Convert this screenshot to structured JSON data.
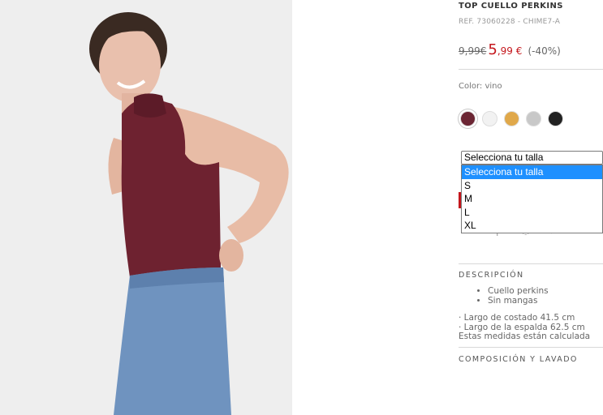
{
  "product": {
    "title": "TOP CUELLO PERKINS",
    "ref": "REF. 73060228 - CHIME7-A",
    "old_price": "9,99€",
    "new_price_int": "5",
    "new_price_dec": ",99 €",
    "discount": "(-40%)",
    "color_label": "Color: vino",
    "colors": [
      "#6b2533",
      "#f2f2f2",
      "#e0a84a",
      "#c8c8c8",
      "#222222"
    ],
    "selected_color": "vino"
  },
  "size_select": {
    "value": "Selecciona tu talla",
    "options": [
      "Selecciona tu talla",
      "S",
      "M",
      "L",
      "XL"
    ],
    "highlighted_index": 0
  },
  "share_icons": [
    "mail-icon",
    "pinterest-icon",
    "whatsapp-icon",
    "twitter-icon",
    "facebook-icon"
  ],
  "description": {
    "heading": "DESCRIPCIÓN",
    "bullets": [
      "Cuello perkins",
      "Sin mangas"
    ],
    "measures": [
      "· Largo de costado 41.5 cm",
      "· Largo de la espalda 62.5 cm",
      "Estas medidas están calculada"
    ]
  },
  "composition": {
    "heading": "COMPOSICIÓN Y LAVADO"
  }
}
